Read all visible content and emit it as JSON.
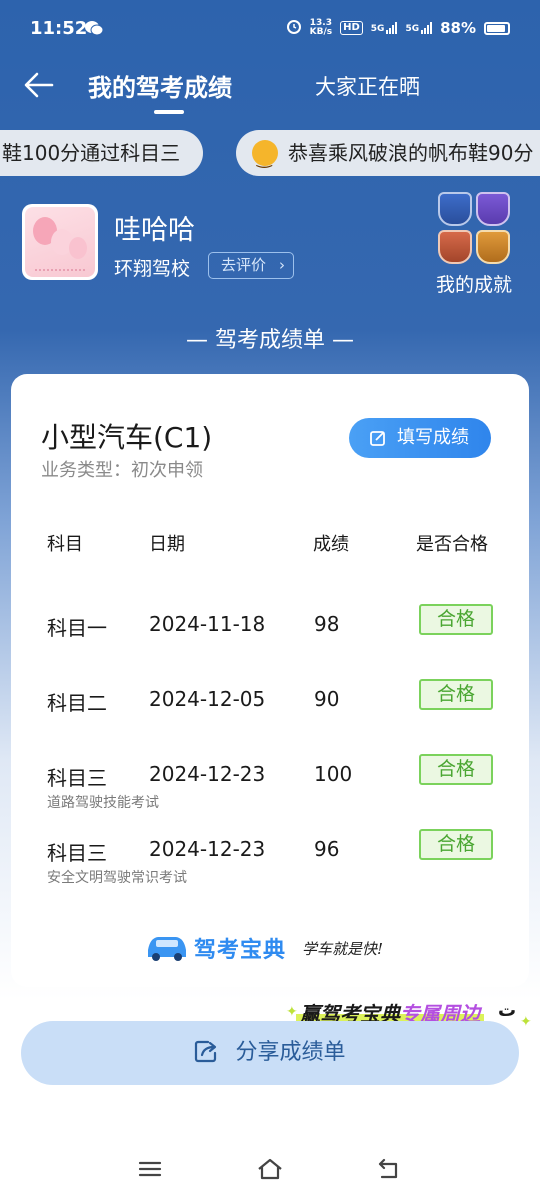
{
  "status": {
    "time": "11:52",
    "net_speed_top": "13.3",
    "net_speed_bottom": "KB/s",
    "hd": "HD",
    "sim1": "5G",
    "sim2": "5G",
    "battery": "88%"
  },
  "header": {
    "tab_active": "我的驾考成绩",
    "tab_other": "大家正在晒"
  },
  "marquee": [
    {
      "text": "鞋100分通过科目三"
    },
    {
      "text": "恭喜乘风破浪的帆布鞋90分"
    }
  ],
  "profile": {
    "username": "哇哈哈",
    "school": "环翔驾校",
    "rate_label": "去评价",
    "achievements_label": "我的成就"
  },
  "section_title": "— 驾考成绩单 —",
  "card": {
    "car_type": "小型汽车(C1)",
    "business_type": "业务类型：初次申领",
    "fill_label": "填写成绩",
    "headers": [
      "科目",
      "日期",
      "成绩",
      "是否合格"
    ],
    "rows": [
      {
        "subject": "科目一",
        "date": "2024-11-18",
        "score": "98",
        "pass": "合格",
        "note": ""
      },
      {
        "subject": "科目二",
        "date": "2024-12-05",
        "score": "90",
        "pass": "合格",
        "note": ""
      },
      {
        "subject": "科目三",
        "date": "2024-12-23",
        "score": "100",
        "pass": "合格",
        "note": "道路驾驶技能考试"
      },
      {
        "subject": "科目三",
        "date": "2024-12-23",
        "score": "96",
        "pass": "合格",
        "note": "安全文明驾驶常识考试"
      }
    ],
    "brand_name": "驾考宝典",
    "brand_slogan": "学车就是快!"
  },
  "promo": {
    "prefix": "赢驾考宝典",
    "highlight": "专属周边"
  },
  "share_label": "分享成绩单",
  "colors": {
    "header_blue": "#2d63ad",
    "accent_blue": "#2f85ec",
    "pass_green": "#4aa632"
  }
}
